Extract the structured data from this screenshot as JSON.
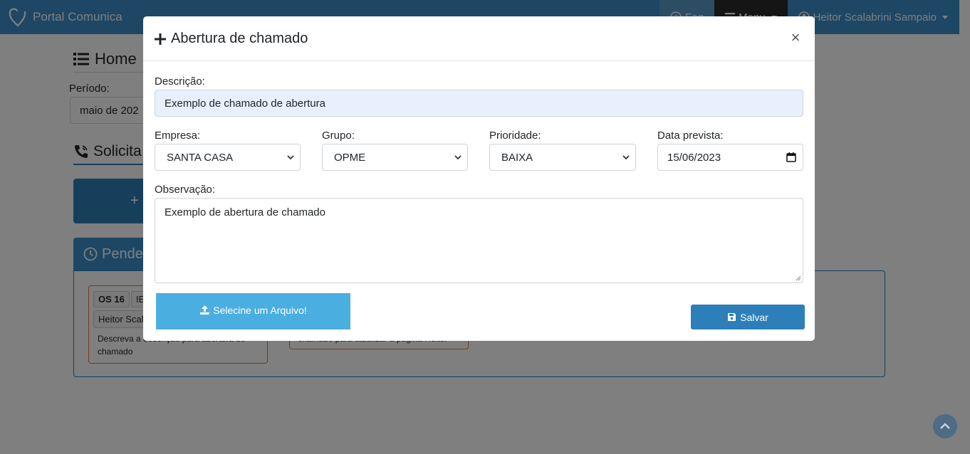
{
  "navbar": {
    "brand": "Portal Comunica",
    "faq_label": "Faq",
    "menu_label": "Menu",
    "user_name": "Heitor Scalabrini Sampaio"
  },
  "background_page": {
    "title": "Home",
    "period_label": "Período:",
    "period_value": "maio de 202",
    "section_title": "Solicita",
    "new_button_label": "+",
    "pending_title": "Pende",
    "ticket": {
      "os": "OS 16",
      "ie": "IE",
      "user": "Heitor Scala",
      "description": "Descreva a descrição para abertura de chamado"
    },
    "ticket2_description": "chamado para atualizar a página Heitor"
  },
  "modal": {
    "title": "Abertura de chamado",
    "close_glyph": "×",
    "descricao_label": "Descrição:",
    "descricao_value": "Exemplo de chamado de abertura",
    "empresa_label": "Empresa:",
    "empresa_value": "SANTA CASA",
    "grupo_label": "Grupo:",
    "grupo_value": "OPME",
    "prioridade_label": "Prioridade:",
    "prioridade_value": "BAIXA",
    "data_label": "Data prevista:",
    "data_value": "15/06/2023",
    "observacao_label": "Observação:",
    "observacao_value": "Exemplo de abertura de chamado",
    "upload_label": "Selecine um Arquivo!",
    "save_label": "Salvar"
  },
  "colors": {
    "navbar": "#3a8fc9",
    "primary": "#2c7fb8",
    "upload": "#4aaee0",
    "autofill": "#e8f0fe",
    "ticket_border": "#e07a35"
  }
}
